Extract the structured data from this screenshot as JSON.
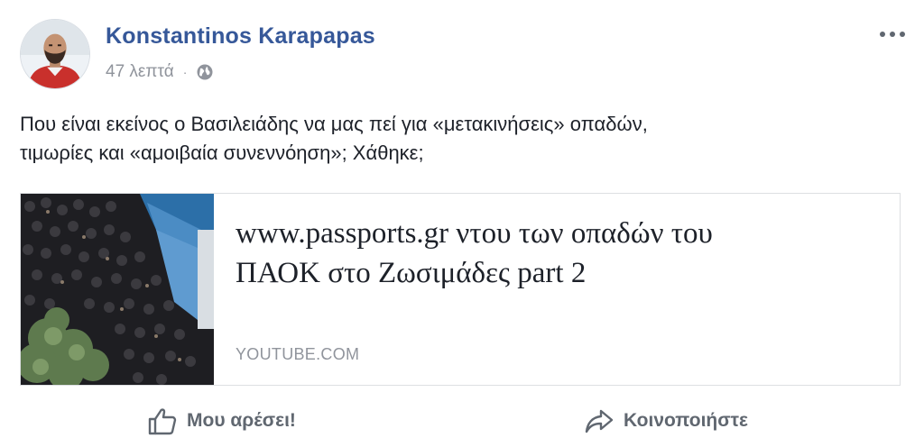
{
  "post": {
    "author": "Konstantinos Karapapas",
    "time": "47 λεπτά",
    "separator": "·",
    "privacy_icon": "globe-icon",
    "more_icon": "more-options-icon",
    "text_lines": [
      "Που είναι εκείνος ο Βασιλειάδης να μας πεί για «μετακινήσεις» οπαδών,",
      "τιμωρίες και «αμοιβαία συνεννόηση»; Χάθηκε;"
    ]
  },
  "link": {
    "title_line1": "www.passports.gr ντου των οπαδών του",
    "title_line2": "ΠΑΟΚ στο Ζωσιμάδες part 2",
    "domain": "YOUTUBE.COM"
  },
  "actions": {
    "like_label": "Μου αρέσει!",
    "like_icon": "thumbs-up-icon",
    "share_label": "Κοινοποιήστε",
    "share_icon": "share-arrow-icon"
  },
  "colors": {
    "author_link": "#365899",
    "meta_text": "#90949c",
    "body_text": "#1d2129",
    "action_text": "#606770",
    "card_border": "#dddfe2"
  }
}
